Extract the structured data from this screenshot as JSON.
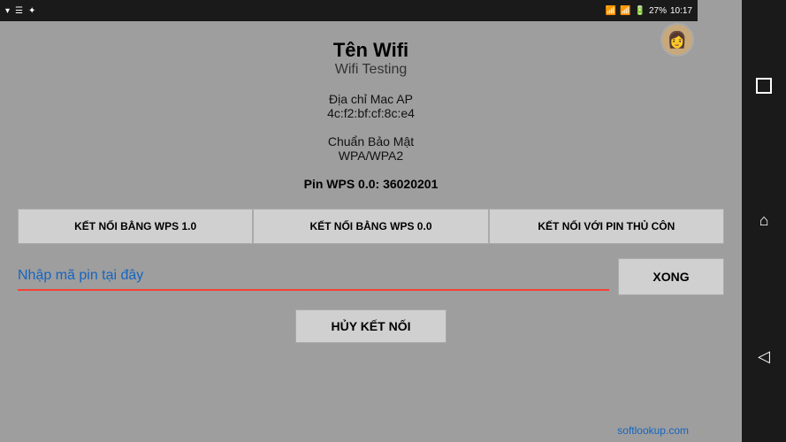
{
  "status_bar": {
    "time": "10:17",
    "battery": "27%"
  },
  "header": {
    "wifi_name_label": "Tên Wifi",
    "wifi_name_value": "Wifi Testing",
    "mac_label": "Địa chỉ Mac AP",
    "mac_value": "4c:f2:bf:cf:8c:e4",
    "security_label": "Chuẩn Bảo Mật",
    "security_value": "WPA/WPA2",
    "pin_wps_label": "Pin WPS 0.0: 36020201"
  },
  "buttons": {
    "wps1": "KẾT NỐI BẰNG WPS 1.0",
    "wps0": "KẾT NỐI BẰNG WPS 0.0",
    "wps_pin": "KẾT NỐI VỚI PIN THỦ CÔN",
    "xong": "XONG",
    "cancel": "HỦY KẾT NỐI"
  },
  "pin_input": {
    "placeholder": "Nhập mã pin tại đây"
  },
  "watermark": "softlookup.com",
  "nav": {
    "square": "□",
    "home": "⌂",
    "back": "◁"
  }
}
